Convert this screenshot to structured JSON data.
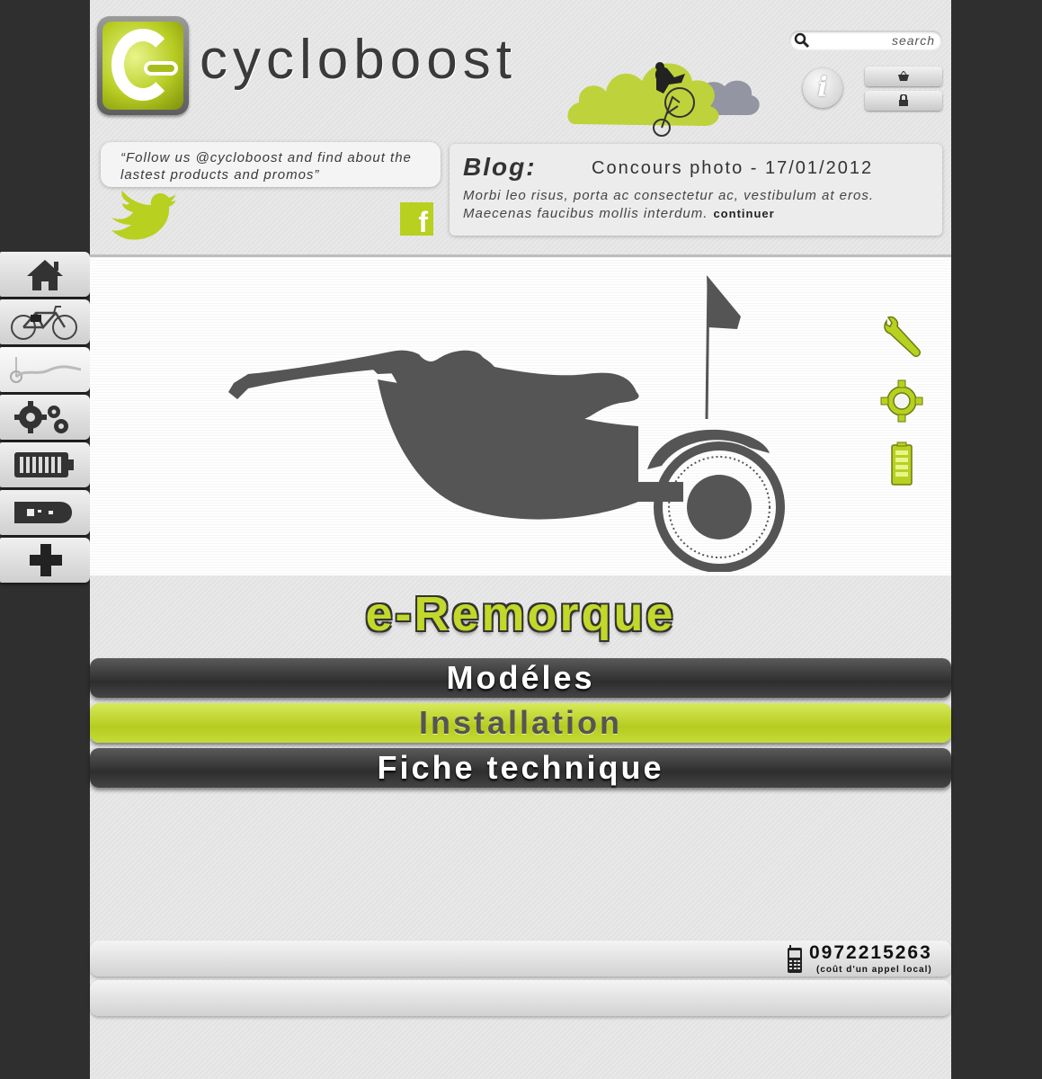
{
  "header": {
    "brand": "cycloboost",
    "search_placeholder": "search",
    "info_label": "i",
    "cart_icon": "basket-icon",
    "lock_icon": "lock-icon"
  },
  "social": {
    "tweet_text": "“Follow us @cycloboost and find about the lastest products and promos”",
    "facebook_label": "f"
  },
  "blog": {
    "label": "Blog:",
    "title": "Concours photo - 17/01/2012",
    "excerpt": "Morbi leo risus, porta ac consectetur ac, vestibulum at eros. Maecenas faucibus mollis interdum.",
    "more": "continuer"
  },
  "sidenav": {
    "items": [
      "home-icon",
      "bicycle-icon",
      "trailer-icon",
      "gears-icon",
      "battery-icon",
      "motor-icon",
      "plus-icon"
    ]
  },
  "hero": {
    "side_icons": [
      "wrench-icon",
      "gear-icon",
      "battery-icon"
    ]
  },
  "product": {
    "title": "e-Remorque"
  },
  "tabs": [
    {
      "label": "Modéles",
      "active": false
    },
    {
      "label": "Installation",
      "active": true
    },
    {
      "label": "Fiche technique",
      "active": false
    }
  ],
  "footer": {
    "phone": "0972215263",
    "phone_note": "(coût d'un appel local)"
  },
  "colors": {
    "accent": "#c2d82a",
    "dark": "#2f2f2f"
  }
}
